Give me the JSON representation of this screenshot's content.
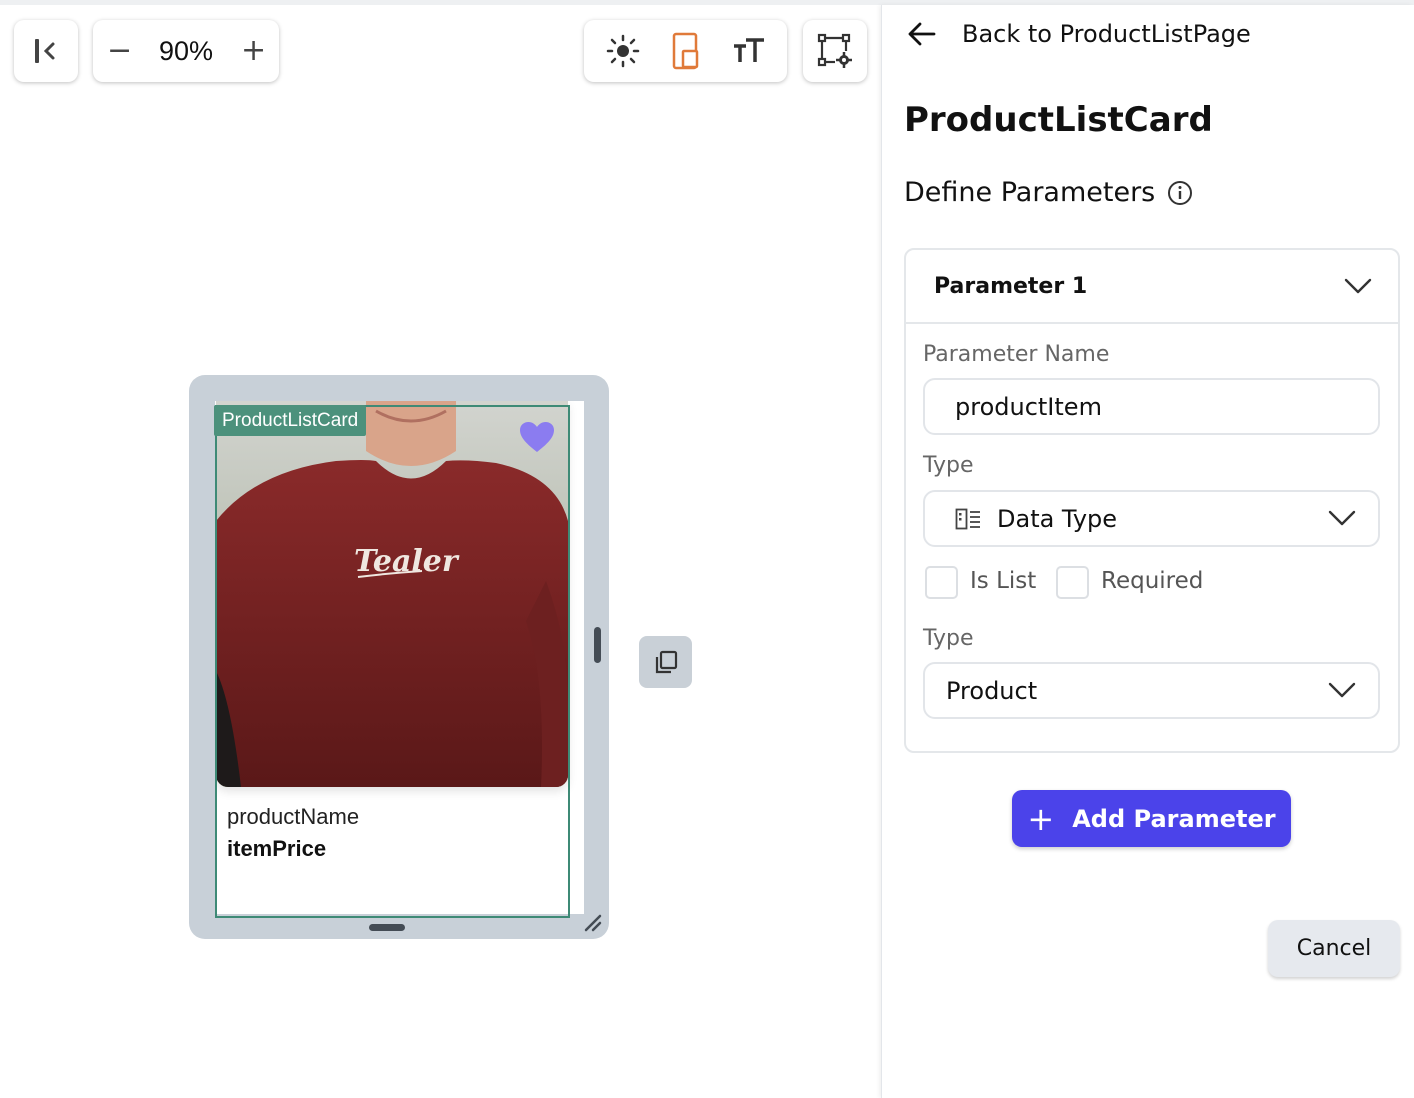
{
  "toolbar": {
    "zoom_value": "90%",
    "zoom_out_label": "−",
    "zoom_in_label": "+",
    "icons": [
      "collapse-panel-icon",
      "sun-icon",
      "device-icon",
      "text-size-icon",
      "widget-settings-icon"
    ],
    "device_icon_color": "#e07a3a"
  },
  "preview": {
    "component_label": "ProductListCard",
    "product_name": "productName",
    "item_price": "itemPrice",
    "shirt_text": "Tealer",
    "heart_color": "#8b7cf0",
    "accent_color": "#4c917c"
  },
  "panel": {
    "back_label": "Back to ProductListPage",
    "title": "ProductListCard",
    "define_label": "Define Parameters",
    "parameter": {
      "header": "Parameter 1",
      "name_label": "Parameter Name",
      "name_value": "productItem",
      "type_label": "Type",
      "type_value": "Data Type",
      "is_list_label": "Is List",
      "required_label": "Required",
      "subtype_label": "Type",
      "subtype_value": "Product"
    },
    "add_button": "Add Parameter",
    "cancel_button": "Cancel",
    "primary_color": "#4b43ea"
  }
}
